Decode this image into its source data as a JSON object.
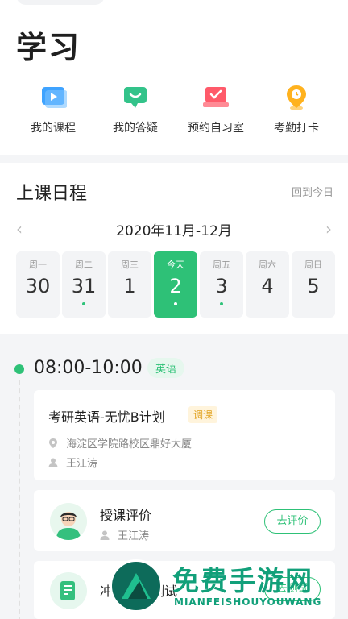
{
  "page": {
    "title": "学习"
  },
  "quick_actions": [
    {
      "label": "我的课程",
      "icon": "video-course-icon"
    },
    {
      "label": "我的答疑",
      "icon": "chat-qa-icon"
    },
    {
      "label": "预约自习室",
      "icon": "laptop-room-icon"
    },
    {
      "label": "考勤打卡",
      "icon": "location-pin-icon"
    }
  ],
  "schedule": {
    "title": "上课日程",
    "back_today": "回到今日",
    "month_range": "2020年11月-12月",
    "days": [
      {
        "weekday": "周一",
        "date": "30",
        "has_class": false,
        "active": false
      },
      {
        "weekday": "周二",
        "date": "31",
        "has_class": true,
        "active": false
      },
      {
        "weekday": "周三",
        "date": "1",
        "has_class": false,
        "active": false
      },
      {
        "weekday": "今天",
        "date": "2",
        "has_class": true,
        "active": true
      },
      {
        "weekday": "周五",
        "date": "3",
        "has_class": true,
        "active": false
      },
      {
        "weekday": "周六",
        "date": "4",
        "has_class": false,
        "active": false
      },
      {
        "weekday": "周日",
        "date": "5",
        "has_class": false,
        "active": false
      }
    ]
  },
  "session": {
    "time": "08:00-10:00",
    "subject": "英语",
    "course": {
      "title": "考研英语-无忧B计划",
      "tag": "调课",
      "location": "海淀区学院路校区鼎好大厦",
      "teacher": "王江涛"
    },
    "review": {
      "title": "授课评价",
      "teacher": "王江涛",
      "button": "去评价"
    },
    "test": {
      "title": "冲刺阶段测试",
      "button": "去测试"
    }
  },
  "watermark": {
    "cn": "免费手游网",
    "en": "MIANFEISHOUYOUWANG"
  },
  "colors": {
    "accent": "#2ec177",
    "tag_bg": "#fff4dc",
    "tag_fg": "#e0a01c"
  }
}
